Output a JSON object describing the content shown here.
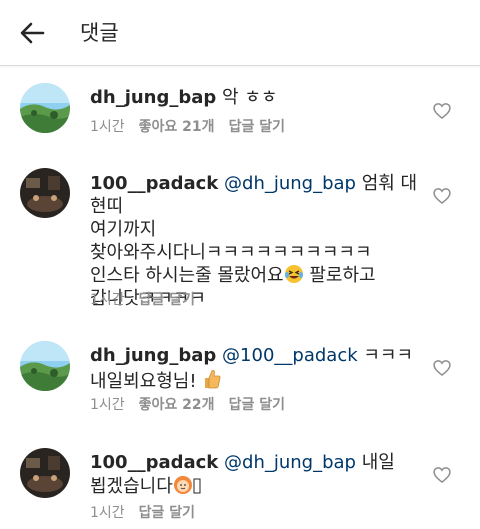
{
  "header": {
    "title": "댓글",
    "back_icon": "arrow-left-icon"
  },
  "comments": [
    {
      "username": "dh_jung_bap",
      "mention": "",
      "text": " 악 ㅎㅎ",
      "time": "1시간",
      "likes": "좋아요 21개",
      "reply": "답글 달기",
      "avatar": "landscape"
    },
    {
      "username": "100__padack",
      "mention": "@dh_jung_bap",
      "text_line1": " 엄훠 대현띠",
      "text_line2": "여기까지",
      "text_line3": "찾아와주시다니ㅋㅋㅋㅋㅋㅋㅋㅋㅋㅋ",
      "text_line4": "인스타 하시는줄 몰랐어요",
      "text_line4b": " 팔로하고",
      "text_line5": "갑니닷ㅋㅋㅋㅋ",
      "time": "1시간",
      "reply": "답글 달기",
      "avatar": "dark-room"
    },
    {
      "username": "dh_jung_bap",
      "mention": "@100__padack",
      "text_line1": "  ㅋㅋㅋ",
      "text_line2": "내일뵈요형님! ",
      "time": "1시간",
      "likes": "좋아요 22개",
      "reply": "답글 달기",
      "avatar": "landscape"
    },
    {
      "username": "100__padack",
      "mention": "@dh_jung_bap",
      "text_line1": " 내일",
      "text_line2": "뵙겠습니다",
      "time": "1시간",
      "reply": "답글 달기",
      "avatar": "dark-room"
    }
  ],
  "colors": {
    "mention": "#00376b",
    "meta": "#8e8e8e",
    "text": "#262626",
    "divider": "#dbdbdb"
  },
  "icons": {
    "like": "heart-outline-icon"
  }
}
